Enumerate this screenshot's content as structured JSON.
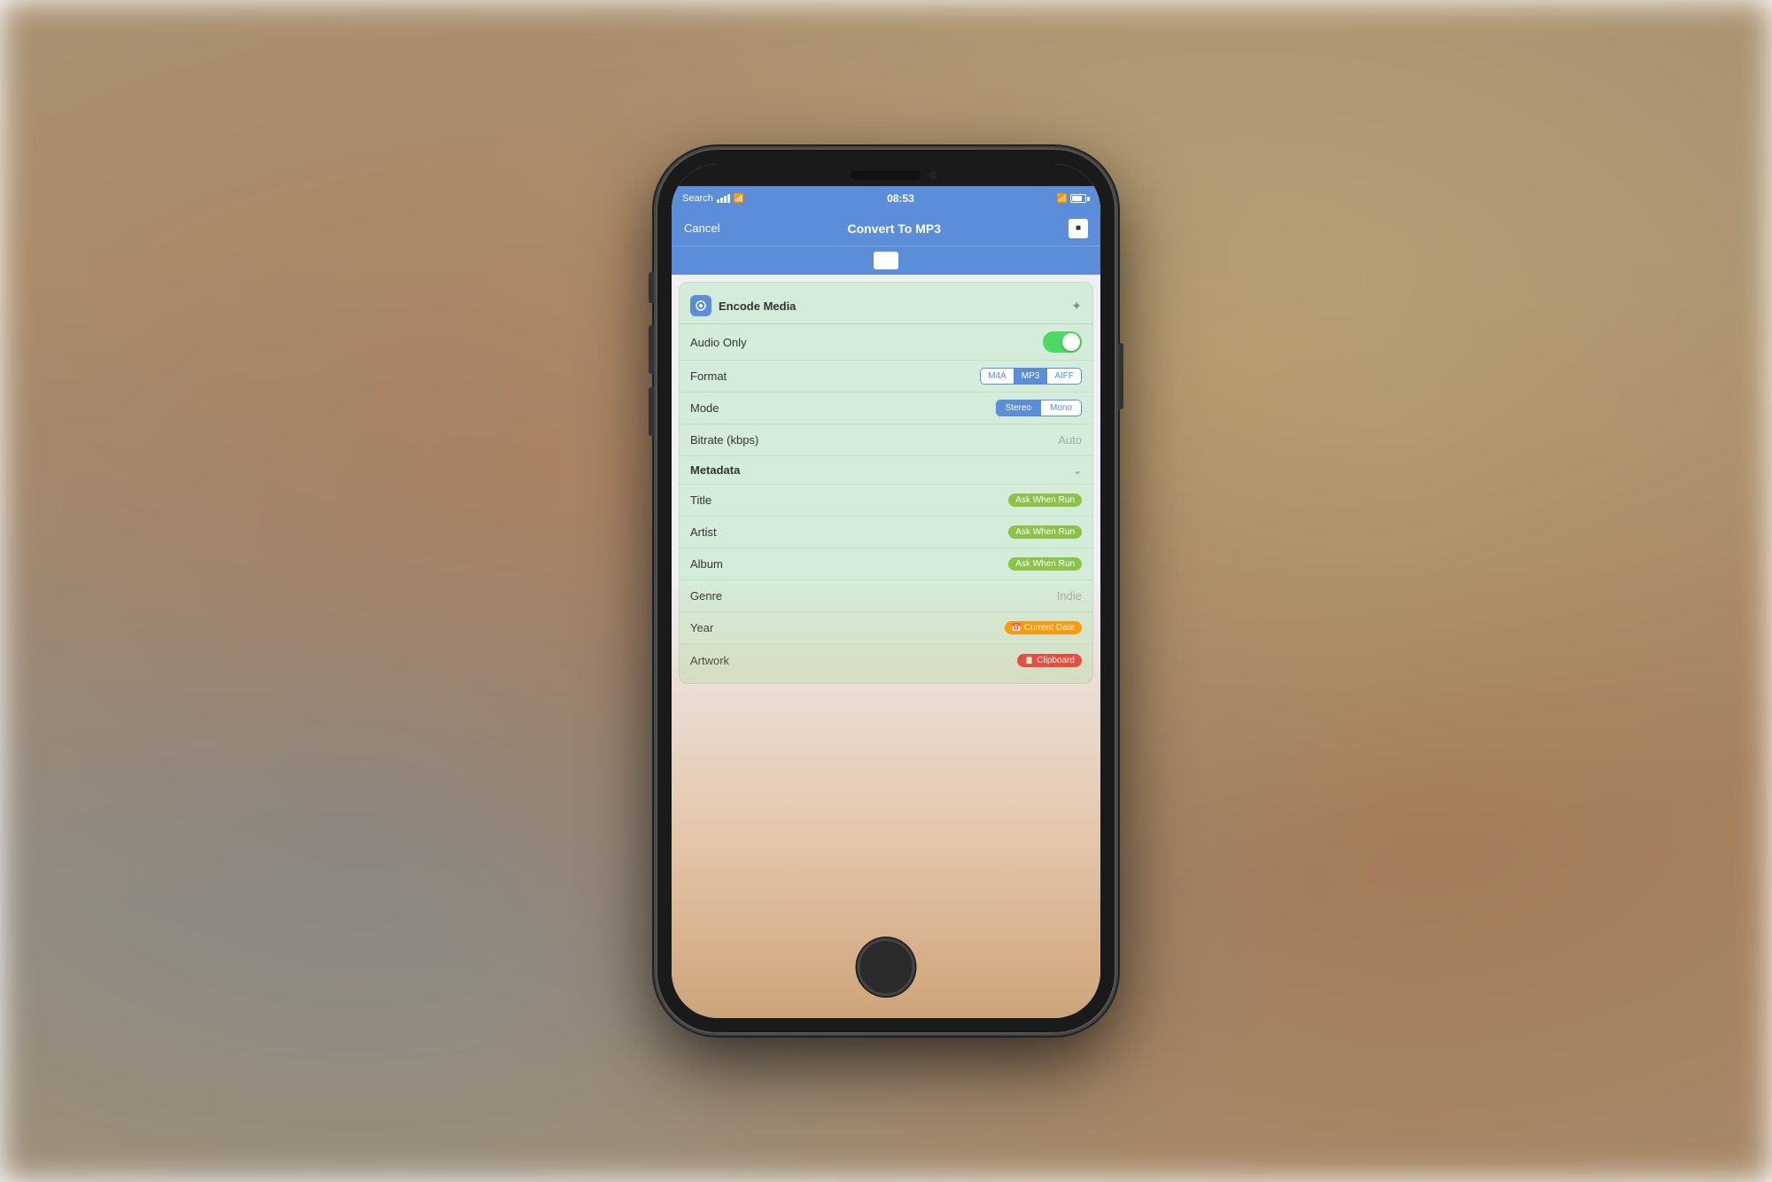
{
  "background": {
    "colors": [
      "#a89070",
      "#c8b478",
      "#b06040"
    ]
  },
  "status_bar": {
    "carrier": "Search",
    "time": "08:53",
    "signal": "●●●",
    "wifi": "wifi",
    "bluetooth": "B",
    "battery": "battery"
  },
  "nav_bar": {
    "cancel_label": "Cancel",
    "title": "Convert To MP3",
    "done_icon": "square"
  },
  "card": {
    "title": "Encode Media",
    "icon": "🔍",
    "settings_icon": "✦"
  },
  "form": {
    "audio_only_label": "Audio Only",
    "audio_only_value": "on",
    "format_label": "Format",
    "format_options": [
      "M4A",
      "MP3",
      "AIFF"
    ],
    "format_selected": "MP3",
    "mode_label": "Mode",
    "mode_options": [
      "Stereo",
      "Mono"
    ],
    "mode_selected": "Stereo",
    "bitrate_label": "Bitrate (kbps)",
    "bitrate_value": "Auto",
    "metadata_label": "Metadata",
    "title_label": "Title",
    "title_value": "Ask When Run",
    "artist_label": "Artist",
    "artist_value": "Ask When Run",
    "album_label": "Album",
    "album_value": "Ask When Run",
    "genre_label": "Genre",
    "genre_value": "Indie",
    "year_label": "Year",
    "year_value": "Current Date",
    "artwork_label": "Artwork",
    "artwork_value": "Clipboard"
  }
}
